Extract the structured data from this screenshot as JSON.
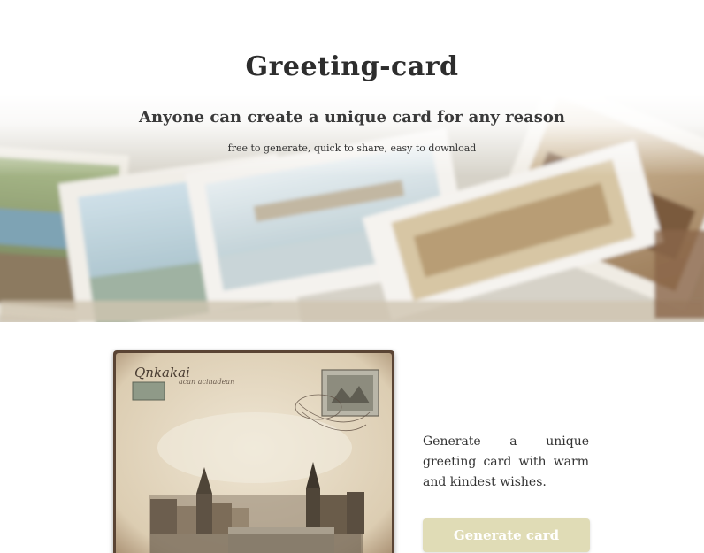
{
  "hero": {
    "title": "Greeting-card",
    "subtitle": "Anyone can create a unique card for any reason",
    "tagline": "free to generate, quick to share, easy to download"
  },
  "preview": {
    "handwriting_top": "Qnkakai",
    "handwriting_sub": "acan acinadean"
  },
  "main": {
    "description": "Generate a unique greeting card with warm and kindest wishes.",
    "generate_label": "Generate card"
  },
  "colors": {
    "button_bg": "#e0dcb6",
    "button_text": "#ffffff",
    "paper": "#e8dcc6",
    "card_frame": "#5a4434"
  }
}
